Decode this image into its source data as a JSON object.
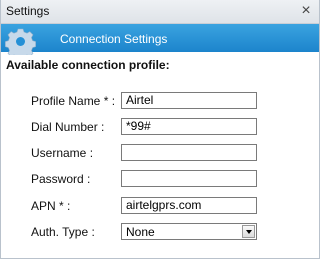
{
  "window": {
    "title": "Settings",
    "close_glyph": "×"
  },
  "header": {
    "label": "Connection Settings",
    "icon": "gear-icon",
    "color": "#2590d6"
  },
  "section": {
    "title": "Available connection profile:"
  },
  "form": {
    "profile_name": {
      "label": "Profile Name * :",
      "value": "Airtel"
    },
    "dial_number": {
      "label": "Dial Number :",
      "value": "*99#"
    },
    "username": {
      "label": "Username :",
      "value": ""
    },
    "password": {
      "label": "Password :",
      "value": ""
    },
    "apn": {
      "label": "APN * :",
      "value": "airtelgprs.com"
    },
    "auth_type": {
      "label": "Auth. Type :",
      "selected": "None"
    }
  }
}
